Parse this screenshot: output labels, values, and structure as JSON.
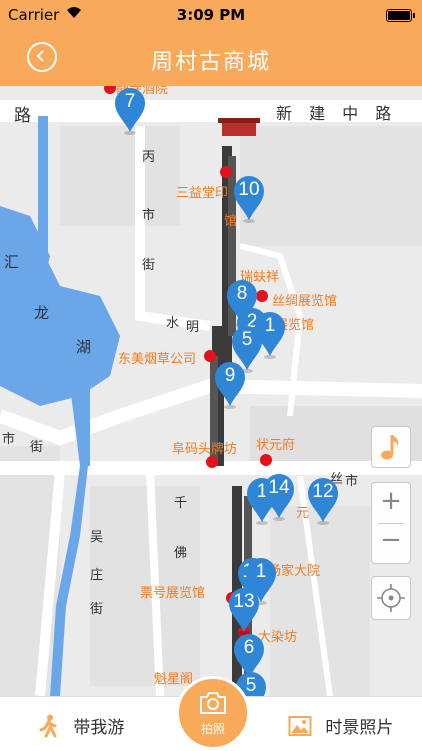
{
  "status": {
    "carrier": "Carrier",
    "time": "3:09 PM"
  },
  "nav": {
    "title": "周村古商城"
  },
  "map": {
    "roads": {
      "xinjianzhong": "新 建 中 路",
      "lu_left": "路",
      "shi": "市",
      "jie_left": "街",
      "hui": "汇",
      "long": "龙",
      "hu": "湖",
      "bingtong": "丙",
      "shi2": "市",
      "jie2": "街",
      "shui": "水",
      "ming": "明",
      "jie_bottom": "街",
      "jie_bottom2": "街",
      "si": "丝",
      "shi3": "市",
      "qian": "千",
      "fo": "佛",
      "yan": "吴",
      "zhuang": "庄",
      "lu_right": "路"
    },
    "pois": {
      "sanyitang": "三益堂印",
      "guan": "馆",
      "ruifuxiang": "瑞蚨祥",
      "sichou": "丝绸展览馆",
      "zhanlan": "展览馆",
      "yancao": "东美烟草公司",
      "fumatou": "阜码头牌坊",
      "zhuangyuan": "状元府",
      "yuan": "元",
      "yangjia": "杨家大院",
      "piaohao": "票号展览馆",
      "darangfang": "大染坊",
      "kuixing": "魁星阁",
      "jiuyuan": "静寺酒院"
    },
    "pins": [
      "7",
      "10",
      "8",
      "2",
      "1",
      "5",
      "9",
      "1",
      "14",
      "12",
      "16",
      "1",
      "13",
      "6",
      "5"
    ]
  },
  "controls": {
    "music_icon": "music-note-icon",
    "zoom_in": "+",
    "zoom_out": "−",
    "locate_icon": "locate-icon"
  },
  "bottom": {
    "guide_label": "带我游",
    "camera_label": "拍照",
    "photos_label": "时景照片"
  },
  "colors": {
    "accent": "#f9a95a",
    "pin": "#2f86d6",
    "poi_text": "#f27c1f",
    "poi_dot": "#e4101a",
    "water": "#6aa6e8"
  }
}
